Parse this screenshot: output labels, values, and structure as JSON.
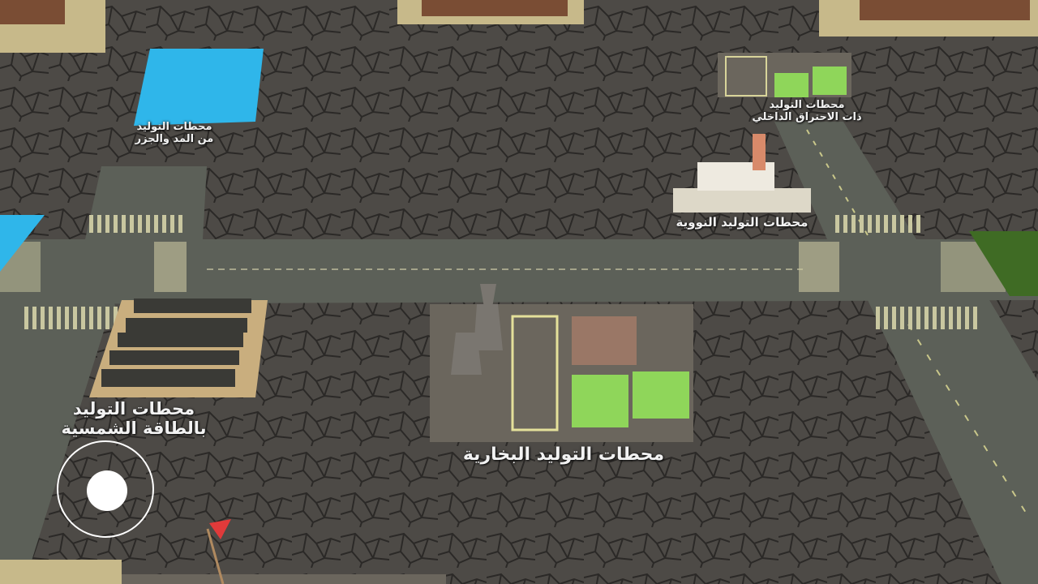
{
  "stations": {
    "tidal": {
      "line1": "محطات التوليد",
      "line2": "من المد والجزر"
    },
    "combustion": {
      "line1": "محطات التوليد",
      "line2": "ذات الاحتراق الداخلي"
    },
    "nuclear": {
      "line1": "محطات التوليد النووية"
    },
    "solar": {
      "line1": "محطات التوليد",
      "line2": "بالطاقة الشمسية"
    },
    "steam": {
      "line1": "محطات التوليد البخارية"
    }
  },
  "colors": {
    "ground": "#4a4744",
    "road": "#5c6058",
    "water": "#2fb6ea",
    "grass": "#3f6b24",
    "green_block": "#8fd65a",
    "flag": "#e03a3a"
  }
}
